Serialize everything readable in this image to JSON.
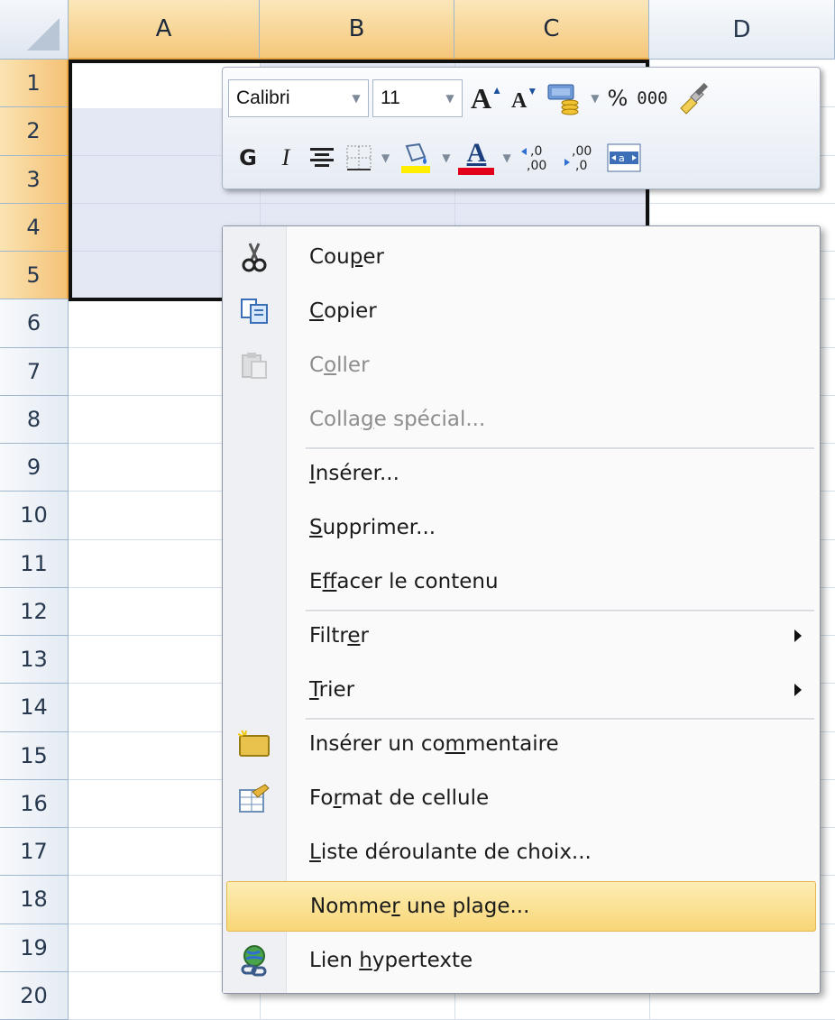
{
  "columns": [
    {
      "label": "A",
      "selected": true
    },
    {
      "label": "B",
      "selected": true
    },
    {
      "label": "C",
      "selected": true
    },
    {
      "label": "D",
      "selected": false
    }
  ],
  "rows": [
    "1",
    "2",
    "3",
    "4",
    "5",
    "6",
    "7",
    "8",
    "9",
    "10",
    "11",
    "12",
    "13",
    "14",
    "15",
    "16",
    "17",
    "18",
    "19",
    "20"
  ],
  "selected_rows": [
    "1",
    "2",
    "3",
    "4",
    "5"
  ],
  "mini_toolbar": {
    "font_name": "Calibri",
    "font_size": "11",
    "increase_font_label": "A",
    "decrease_font_label": "A",
    "percent_label": "%",
    "thousands_label": "000",
    "bold_label": "G",
    "italic_label": "I",
    "font_color_label": "A",
    "increase_decimal_label": ",0 ,00",
    "decrease_decimal_label": ",00 ,0"
  },
  "context_menu": {
    "items": [
      {
        "pre": "Cou",
        "ul": "p",
        "post": "er",
        "enabled": true,
        "submenu": false,
        "icon": "cut-icon"
      },
      {
        "pre": "",
        "ul": "C",
        "post": "opier",
        "enabled": true,
        "submenu": false,
        "icon": "copy-icon"
      },
      {
        "pre": "C",
        "ul": "o",
        "post": "ller",
        "enabled": false,
        "submenu": false,
        "icon": "paste-icon"
      },
      {
        "pre": "Colla",
        "ul": "g",
        "post": "e spécial...",
        "enabled": false,
        "submenu": false,
        "icon": ""
      },
      {
        "pre": "",
        "ul": "I",
        "post": "nsérer...",
        "enabled": true,
        "submenu": false,
        "icon": ""
      },
      {
        "pre": "",
        "ul": "S",
        "post": "upprimer...",
        "enabled": true,
        "submenu": false,
        "icon": ""
      },
      {
        "pre": "E",
        "ul": "f",
        "post": "facer le contenu",
        "enabled": true,
        "submenu": false,
        "icon": ""
      },
      {
        "pre": "Filtr",
        "ul": "e",
        "post": "r",
        "enabled": true,
        "submenu": true,
        "icon": ""
      },
      {
        "pre": "",
        "ul": "T",
        "post": "rier",
        "enabled": true,
        "submenu": true,
        "icon": ""
      },
      {
        "pre": "Insérer un co",
        "ul": "m",
        "post": "mentaire",
        "enabled": true,
        "submenu": false,
        "icon": "comment-icon"
      },
      {
        "pre": "Fo",
        "ul": "r",
        "post": "mat de cellule",
        "enabled": true,
        "submenu": false,
        "icon": "format-cells-icon"
      },
      {
        "pre": "",
        "ul": "L",
        "post": "iste déroulante de choix...",
        "enabled": true,
        "submenu": false,
        "icon": ""
      },
      {
        "pre": "Nomme",
        "ul": "r",
        "post": " une plage...",
        "enabled": true,
        "submenu": false,
        "icon": "",
        "highlighted": true
      },
      {
        "pre": "Lien ",
        "ul": "h",
        "post": "ypertexte",
        "enabled": true,
        "submenu": false,
        "icon": "hyperlink-icon"
      }
    ]
  },
  "colors": {
    "selection_header": "#f5c77a",
    "menu_highlight": "#f8d676",
    "highlight_bar": "#ffee00",
    "font_color_bar": "#e2001a"
  }
}
